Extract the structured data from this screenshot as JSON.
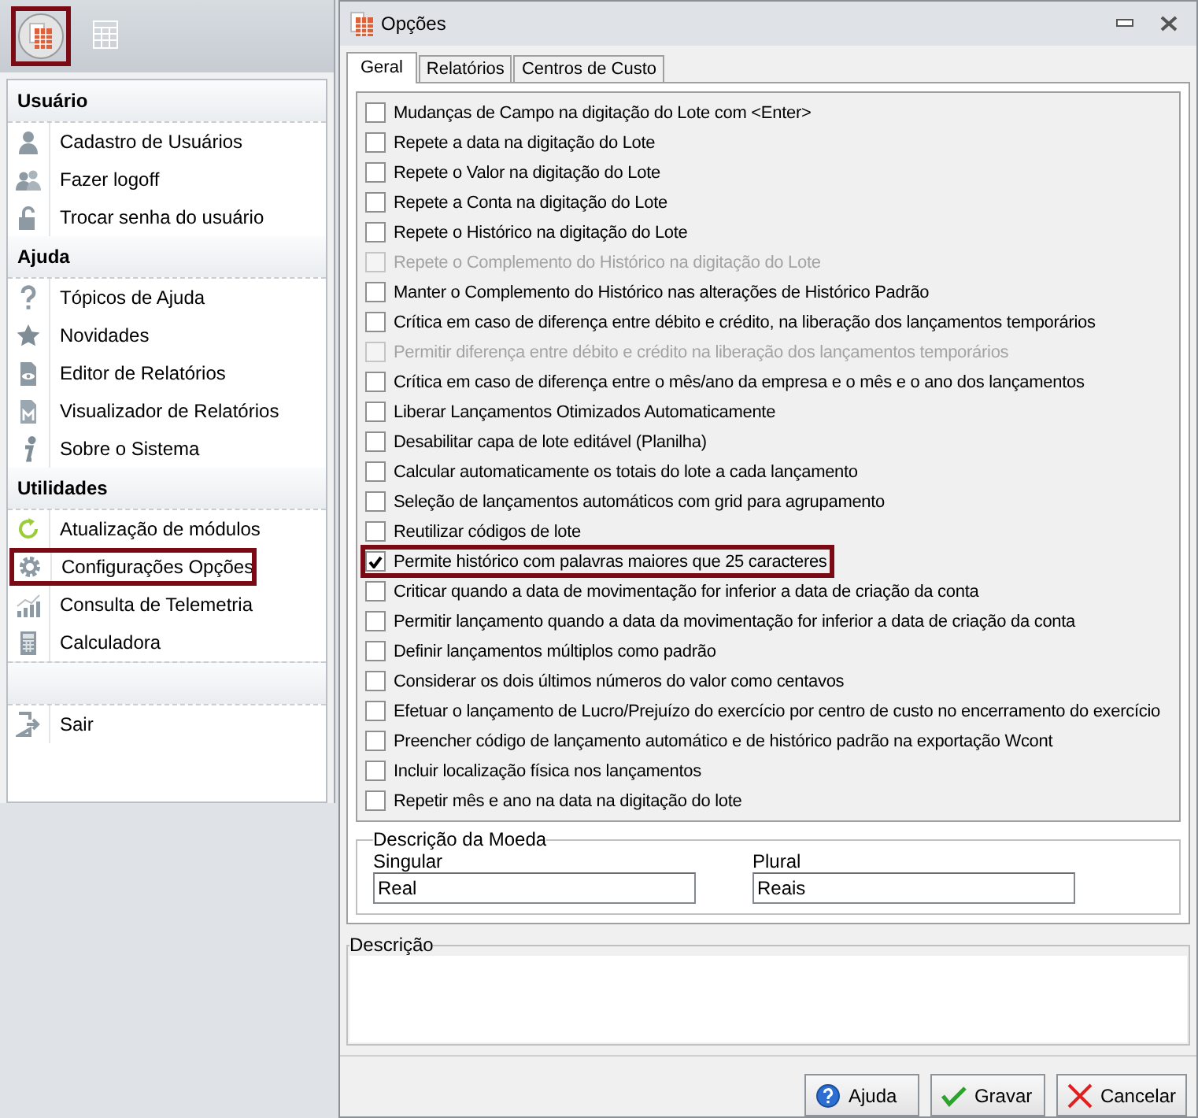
{
  "app_button": {
    "highlighted": true
  },
  "menu": {
    "sections": [
      {
        "title": "Usuário",
        "items": [
          {
            "label": "Cadastro de Usuários",
            "highlighted": false
          },
          {
            "label": "Fazer logoff",
            "highlighted": false
          },
          {
            "label": "Trocar senha do usuário",
            "highlighted": false
          }
        ]
      },
      {
        "title": "Ajuda",
        "items": [
          {
            "label": "Tópicos de Ajuda",
            "highlighted": false
          },
          {
            "label": "Novidades",
            "highlighted": false
          },
          {
            "label": "Editor de Relatórios",
            "highlighted": false
          },
          {
            "label": "Visualizador de Relatórios",
            "highlighted": false
          },
          {
            "label": "Sobre o Sistema",
            "highlighted": false
          }
        ]
      },
      {
        "title": "Utilidades",
        "items": [
          {
            "label": "Atualização de módulos",
            "highlighted": false
          },
          {
            "label": "Configurações Opções",
            "highlighted": true
          },
          {
            "label": "Consulta de Telemetria",
            "highlighted": false
          },
          {
            "label": "Calculadora",
            "highlighted": false
          }
        ]
      },
      {
        "items": [
          {
            "label": "Sair",
            "highlighted": false
          }
        ]
      }
    ]
  },
  "dialog": {
    "title": "Opções",
    "tabs": [
      {
        "label": "Geral",
        "selected": true
      },
      {
        "label": "Relatórios",
        "selected": false
      },
      {
        "label": "Centros de Custo",
        "selected": false
      }
    ],
    "options": [
      {
        "label": "Mudanças de Campo na digitação do Lote com <Enter>",
        "checked": false,
        "disabled": false,
        "highlighted": false
      },
      {
        "label": "Repete a data na digitação do Lote",
        "checked": false,
        "disabled": false,
        "highlighted": false
      },
      {
        "label": "Repete o Valor na digitação do Lote",
        "checked": false,
        "disabled": false,
        "highlighted": false
      },
      {
        "label": "Repete a Conta na digitação do Lote",
        "checked": false,
        "disabled": false,
        "highlighted": false
      },
      {
        "label": "Repete o Histórico na digitação do Lote",
        "checked": false,
        "disabled": false,
        "highlighted": false
      },
      {
        "label": "Repete o Complemento do Histórico na digitação do Lote",
        "checked": false,
        "disabled": true,
        "highlighted": false
      },
      {
        "label": "Manter o Complemento do Histórico nas alterações de Histórico Padrão",
        "checked": false,
        "disabled": false,
        "highlighted": false
      },
      {
        "label": "Crítica em caso de diferença entre débito e crédito, na liberação dos lançamentos temporários",
        "checked": false,
        "disabled": false,
        "highlighted": false
      },
      {
        "label": "Permitir diferença entre débito e crédito na liberação dos lançamentos temporários",
        "checked": false,
        "disabled": true,
        "highlighted": false
      },
      {
        "label": "Crítica em caso de diferença entre o mês/ano da empresa e o mês e o ano dos lançamentos",
        "checked": false,
        "disabled": false,
        "highlighted": false
      },
      {
        "label": "Liberar Lançamentos Otimizados Automaticamente",
        "checked": false,
        "disabled": false,
        "highlighted": false
      },
      {
        "label": "Desabilitar capa de lote editável (Planilha)",
        "checked": false,
        "disabled": false,
        "highlighted": false
      },
      {
        "label": "Calcular automaticamente os totais do lote a cada lançamento",
        "checked": false,
        "disabled": false,
        "highlighted": false
      },
      {
        "label": "Seleção de lançamentos automáticos com grid para agrupamento",
        "checked": false,
        "disabled": false,
        "highlighted": false
      },
      {
        "label": "Reutilizar códigos de lote",
        "checked": false,
        "disabled": false,
        "highlighted": false
      },
      {
        "label": "Permite histórico com palavras maiores que 25 caracteres",
        "checked": true,
        "disabled": false,
        "highlighted": true
      },
      {
        "label": "Criticar quando a data de movimentação for inferior a data de criação da conta",
        "checked": false,
        "disabled": false,
        "highlighted": false
      },
      {
        "label": "Permitir lançamento quando a data da movimentação for inferior a data de criação da conta",
        "checked": false,
        "disabled": false,
        "highlighted": false
      },
      {
        "label": "Definir lançamentos múltiplos como padrão",
        "checked": false,
        "disabled": false,
        "highlighted": false
      },
      {
        "label": "Considerar os dois últimos números do valor como centavos",
        "checked": false,
        "disabled": false,
        "highlighted": false
      },
      {
        "label": "Efetuar o lançamento de Lucro/Prejuízo do exercício por centro de custo no encerramento do exercício",
        "checked": false,
        "disabled": false,
        "highlighted": false
      },
      {
        "label": "Preencher código de lançamento automático e de histórico padrão na exportação Wcont",
        "checked": false,
        "disabled": false,
        "highlighted": false
      },
      {
        "label": "Incluir localização física nos lançamentos",
        "checked": false,
        "disabled": false,
        "highlighted": false
      },
      {
        "label": "Repetir mês e ano na data na digitação do lote",
        "checked": false,
        "disabled": false,
        "highlighted": false
      }
    ],
    "currency": {
      "title": "Descrição da Moeda",
      "fields": [
        {
          "label": "Singular",
          "value": "Real"
        },
        {
          "label": "Plural",
          "value": "Reais"
        }
      ]
    },
    "description": {
      "title": "Descrição"
    },
    "buttons": [
      {
        "label": "Ajuda",
        "kind": "help"
      },
      {
        "label": "Gravar",
        "kind": "save"
      },
      {
        "label": "Cancelar",
        "kind": "cancel"
      }
    ]
  }
}
